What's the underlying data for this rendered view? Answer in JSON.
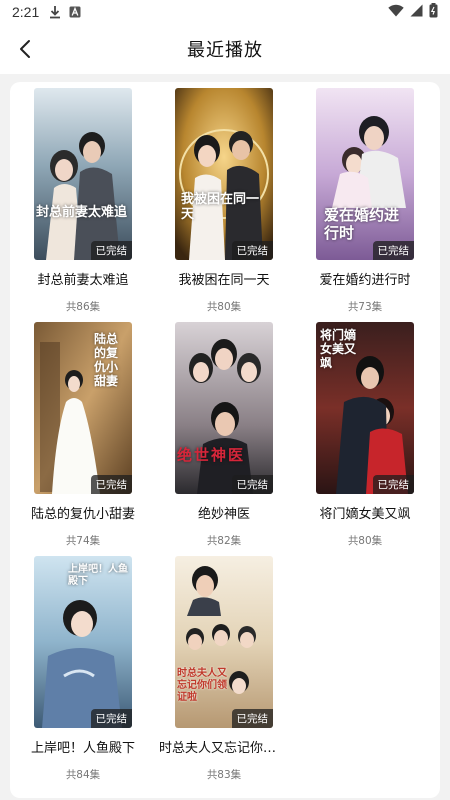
{
  "status_bar": {
    "time": "2:21",
    "icons": [
      "download-icon",
      "font-icon",
      "wifi-icon",
      "signal-icon",
      "battery-icon"
    ]
  },
  "header": {
    "title": "最近播放",
    "back_icon": "back-arrow-icon"
  },
  "colors": {
    "background": "#f2f2f2",
    "card": "#ffffff",
    "badge": "#1e1e1e"
  },
  "dramas": [
    {
      "title": "封总前妻太难追",
      "episodes": "共86集",
      "status": "已完结",
      "poster_text": "封总前妻太难追"
    },
    {
      "title": "我被困在同一天",
      "episodes": "共80集",
      "status": "已完结",
      "poster_text": "我被困在同一天"
    },
    {
      "title": "爱在婚约进行时",
      "episodes": "共73集",
      "status": "已完结",
      "poster_text": "爱在婚约进行时"
    },
    {
      "title": "陆总的复仇小甜妻",
      "episodes": "共74集",
      "status": "已完结",
      "poster_text": "陆总的复仇小甜妻"
    },
    {
      "title": "绝妙神医",
      "episodes": "共82集",
      "status": "已完结",
      "poster_text": "绝世神医"
    },
    {
      "title": "将门嫡女美又飒",
      "episodes": "共80集",
      "status": "已完结",
      "poster_text": "将门嫡女美又飒"
    },
    {
      "title": "上岸吧！人鱼殿下",
      "episodes": "共84集",
      "status": "已完结",
      "poster_text": "上岸吧！人鱼殿下"
    },
    {
      "title": "时总夫人又忘记你们领...",
      "episodes": "共83集",
      "status": "已完结",
      "poster_text": "时总夫人又忘记你们领证啦"
    }
  ]
}
